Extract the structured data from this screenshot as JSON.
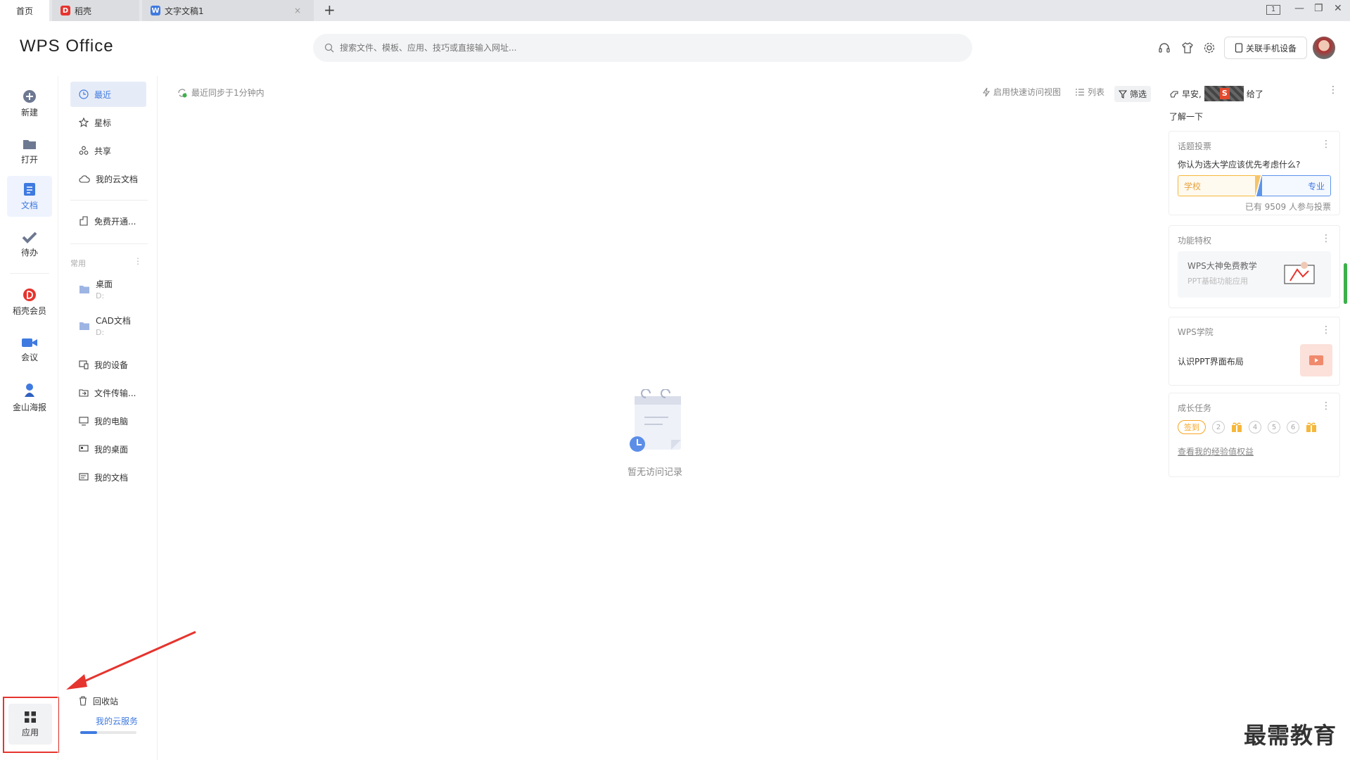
{
  "tabs": {
    "home": "首页",
    "daoke": "稻壳",
    "doc": "文字文稿1",
    "doc_icon": "W",
    "add": "+",
    "close": "×"
  },
  "window": {
    "screen": "1",
    "minimize": "—",
    "restore": "❐",
    "close": "✕"
  },
  "header": {
    "logo": "WPS Office",
    "search_placeholder": "搜索文件、模板、应用、技巧或直接输入网址...",
    "link_phone": "关联手机设备"
  },
  "rail": {
    "new": "新建",
    "open": "打开",
    "docs": "文档",
    "todo": "待办",
    "member": "稻壳会员",
    "meeting": "会议",
    "poster": "金山海报",
    "apps": "应用"
  },
  "nav": {
    "recent": "最近",
    "star": "星标",
    "share": "共享",
    "cloud": "我的云文档",
    "free": "免费开通...",
    "common": "常用",
    "more": "⋮",
    "desktop": "桌面",
    "desktop_sub": "D:",
    "cad": "CAD文档",
    "cad_sub": "D:",
    "device": "我的设备",
    "transfer": "文件传输...",
    "computer": "我的电脑",
    "mydesk": "我的桌面",
    "mydocs": "我的文档",
    "trash": "回收站",
    "cloud_service": "我的云服务",
    "cloud_usage": 0.3
  },
  "main": {
    "sync": "最近同步于1分钟内",
    "quick": "启用快速访问视图",
    "list": "列表",
    "filter": "筛选",
    "empty": "暂无访问记录"
  },
  "right": {
    "greet_prefix": "早安,",
    "greet_suffix": "给了",
    "learn": "了解一下",
    "more": "⋮",
    "vote": {
      "title": "话题投票",
      "question": "你认为选大学应该优先考虑什么?",
      "left": "学校",
      "right": "专业",
      "count": "已有 9509 人参与投票"
    },
    "feature": {
      "title": "功能特权",
      "line1": "WPS大神免费教学",
      "line2": "PPT基础功能应用"
    },
    "academy": {
      "title": "WPS学院",
      "text": "认识PPT界面布局"
    },
    "tasks": {
      "title": "成长任务",
      "checkin": "签到",
      "s2": "2",
      "s4": "4",
      "s5": "5",
      "s6": "6",
      "link": "查看我的经验值权益"
    }
  },
  "watermark": "最需教育",
  "colors": {
    "accent": "#3f7ae0",
    "red": "#e6342e",
    "orange": "#f5a623"
  }
}
